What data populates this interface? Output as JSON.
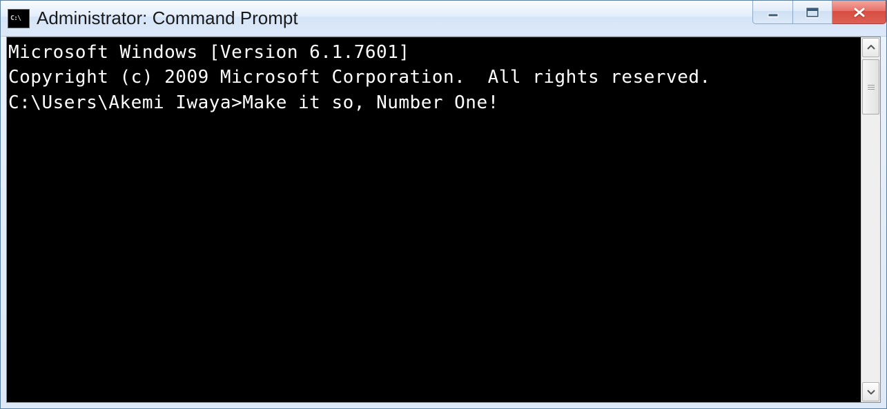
{
  "window": {
    "icon_text": "C:\\",
    "title": "Administrator: Command Prompt"
  },
  "terminal": {
    "line1": "Microsoft Windows [Version 6.1.7601]",
    "line2": "Copyright (c) 2009 Microsoft Corporation.  All rights reserved.",
    "blank": "",
    "prompt": "C:\\Users\\Akemi Iwaya>",
    "command": "Make it so, Number One!"
  }
}
